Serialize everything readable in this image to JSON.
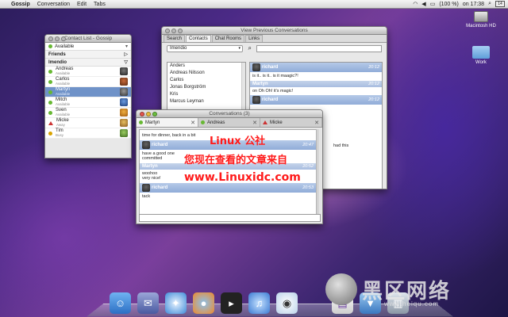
{
  "menubar": {
    "items": [
      "Gossip",
      "Conversation",
      "Edit",
      "Tabs"
    ],
    "battery": "(100 %)",
    "clock": "on 17:38",
    "date_badge": "14"
  },
  "desktop": {
    "icons": [
      "Macintosh HD",
      "Work"
    ]
  },
  "contact_list": {
    "title": "Contact List - Gossip",
    "status": "Available",
    "groups": [
      "Friends",
      "Imendio"
    ],
    "contacts": [
      {
        "name": "Andreas",
        "status": "Available",
        "state": "available"
      },
      {
        "name": "Carlos",
        "status": "Available",
        "state": "available"
      },
      {
        "name": "Martyn",
        "status": "Available",
        "state": "available",
        "selected": true
      },
      {
        "name": "Mitch",
        "status": "Available",
        "state": "available"
      },
      {
        "name": "Sven",
        "status": "Available",
        "state": "available"
      },
      {
        "name": "Micke",
        "status": "Away",
        "state": "away"
      },
      {
        "name": "Tim",
        "status": "Busy",
        "state": "busy"
      }
    ]
  },
  "previous": {
    "title": "View Previous Conversations",
    "tabs": [
      "Search",
      "Contacts",
      "Chat Rooms",
      "Links"
    ],
    "selected_account": "Imendio",
    "contacts": [
      "Anders",
      "Andreas Nilsson",
      "Carlos",
      "Jonas Borgström",
      "Kris",
      "Marcus Leyman"
    ],
    "messages": [
      {
        "user": "richard",
        "time": "20:12",
        "text": "is it.. is it.. is it maagic?!"
      },
      {
        "user": "Martyn",
        "time": "20:12",
        "text": "on Oh Oh! it's magic!"
      },
      {
        "user": "richard",
        "time": "20:12",
        "text": ""
      }
    ],
    "partial_text": "had this"
  },
  "conversations": {
    "title": "Conversations (3)",
    "tabs": [
      {
        "name": "Martyn",
        "state": "available"
      },
      {
        "name": "Andreas",
        "state": "available"
      },
      {
        "name": "Micke",
        "state": "away"
      }
    ],
    "first_line": "time for dinner, back in a bit",
    "messages": [
      {
        "user": "richard",
        "time": "20:47",
        "text": "have a good one\ncommitted"
      },
      {
        "user": "Martyn",
        "time": "20:52",
        "text": "woohoo\nvery nice!"
      },
      {
        "user": "richard",
        "time": "20:53",
        "text": "tack"
      }
    ]
  },
  "watermark": {
    "line1": "Linux 公社",
    "line2": "您现在查看的文章来自",
    "line3": "www.Linuxidc.com"
  },
  "logo": {
    "text": "黑区网络",
    "url": "www.heiqu.com"
  }
}
